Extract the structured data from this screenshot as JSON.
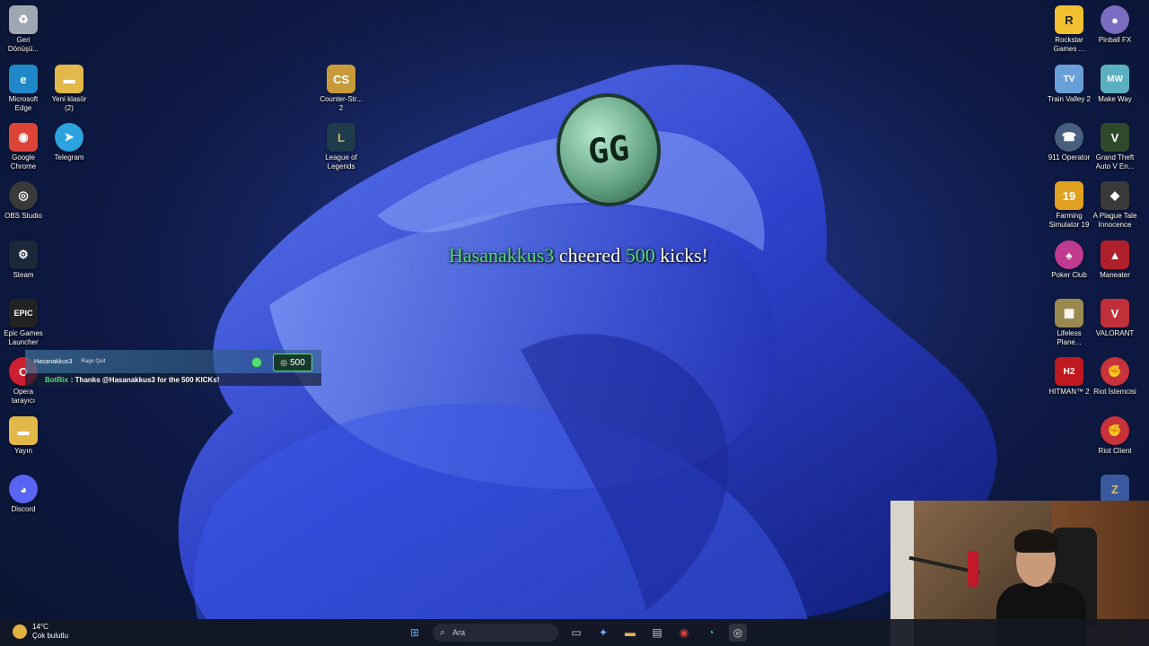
{
  "desktop": {
    "left_icons": [
      {
        "label": "Geri Dönüşü...",
        "color": "#9fa7b3",
        "glyph": "♻"
      },
      {
        "label": "Microsoft Edge",
        "color": "#1e88c8",
        "glyph": "e"
      },
      {
        "label": "Yeni klasör (2)",
        "color": "#e2b84a",
        "glyph": "▬"
      },
      {
        "label": "Google Chrome",
        "color": "#db4437",
        "glyph": "◉"
      },
      {
        "label": "Telegram",
        "color": "#2aa3df",
        "glyph": "➤"
      },
      {
        "label": "OBS Studio",
        "color": "#3a3a3a",
        "glyph": "◎"
      },
      {
        "label": "Steam",
        "color": "#1b2838",
        "glyph": "⚙"
      },
      {
        "label": "Epic Games Launcher",
        "color": "#222222",
        "glyph": "EPIC"
      },
      {
        "label": "Opera tarayıcı",
        "color": "#cc1f2f",
        "glyph": "O"
      },
      {
        "label": "Yayın",
        "color": "#e2b84a",
        "glyph": "▬"
      },
      {
        "label": "Discord",
        "color": "#5865f2",
        "glyph": "◕"
      }
    ],
    "middle_icons": [
      {
        "label": "Counter-Str... 2",
        "color": "#c99a3a",
        "glyph": "CS"
      },
      {
        "label": "League of Legends",
        "color": "#1d3b4a",
        "glyph": "L"
      }
    ],
    "right_icons": [
      {
        "label": "Rockstar Games ...",
        "color": "#f0c030",
        "glyph": "R"
      },
      {
        "label": "Pinball FX",
        "color": "#7a6cc0",
        "glyph": "●"
      },
      {
        "label": "Train Valley 2",
        "color": "#6aa0d8",
        "glyph": "TV"
      },
      {
        "label": "Make Way",
        "color": "#5ab0c0",
        "glyph": "MW"
      },
      {
        "label": "911 Operator",
        "color": "#486080",
        "glyph": "☎"
      },
      {
        "label": "Grand Theft Auto V En...",
        "color": "#2f4a2a",
        "glyph": "V"
      },
      {
        "label": "Farming Simulator 19",
        "color": "#e0a020",
        "glyph": "19"
      },
      {
        "label": "A Plague Tale Innocence",
        "color": "#3a3a3a",
        "glyph": "◆"
      },
      {
        "label": "Poker Club",
        "color": "#c03a90",
        "glyph": "♠"
      },
      {
        "label": "Maneater",
        "color": "#b0202a",
        "glyph": "▲"
      },
      {
        "label": "Lifeless Plane...",
        "color": "#9a8a50",
        "glyph": "▦"
      },
      {
        "label": "VALORANT",
        "color": "#c0303a",
        "glyph": "V"
      },
      {
        "label": "HITMAN™ 2",
        "color": "#c01820",
        "glyph": "H2"
      },
      {
        "label": "Riot İstemcisi",
        "color": "#c8323a",
        "glyph": "✊"
      },
      {
        "label": "Riot Client",
        "color": "#c8323a",
        "glyph": "✊"
      },
      {
        "label": "",
        "color": "#3a5aa0",
        "glyph": "Z"
      }
    ]
  },
  "alert": {
    "coin_text": "GG",
    "username": "Hasanakkus3",
    "verb": "cheered",
    "amount": "500",
    "unit": "kicks!"
  },
  "chat": {
    "user": "Hasanakkus3",
    "reward": "Rage Quit",
    "amount": "500",
    "bot_name": "BotRix",
    "bot_message": ": Thanks @Hasanakkus3 for the 500 KICKs!"
  },
  "taskbar": {
    "temperature": "14°C",
    "weather": "Çok bulutlu",
    "search_placeholder": "Ara"
  }
}
